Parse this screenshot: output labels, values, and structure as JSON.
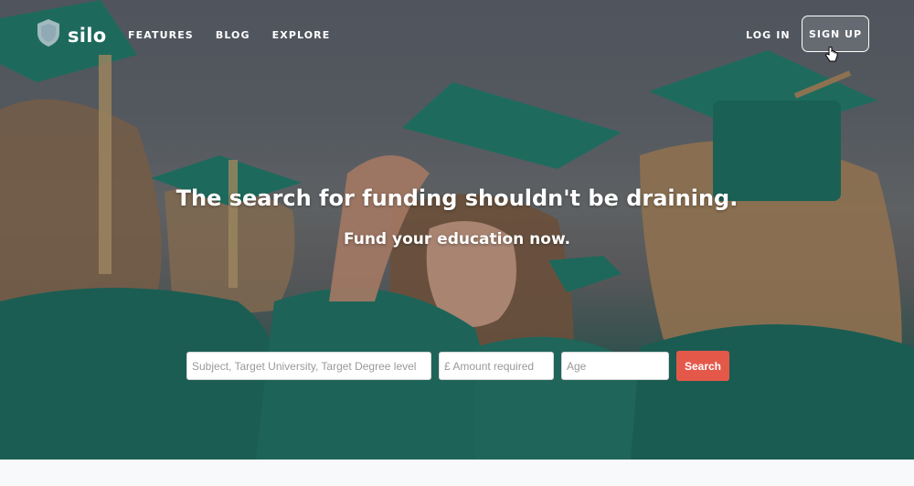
{
  "brand": {
    "name": "silo",
    "accent": "#e4584a"
  },
  "nav": {
    "items": [
      {
        "label": "FEATURES"
      },
      {
        "label": "BLOG"
      },
      {
        "label": "EXPLORE"
      }
    ],
    "login_label": "LOG IN",
    "signup_label": "SIGN UP"
  },
  "hero": {
    "headline": "The search for funding shouldn't be draining.",
    "subheadline": "Fund your education now."
  },
  "search": {
    "subject_placeholder": "Subject, Target University, Target Degree level",
    "amount_placeholder": "£ Amount required",
    "age_placeholder": "Age",
    "button_label": "Search"
  },
  "icons": [
    "shield-logo-icon",
    "hand-pointer-cursor-icon"
  ]
}
